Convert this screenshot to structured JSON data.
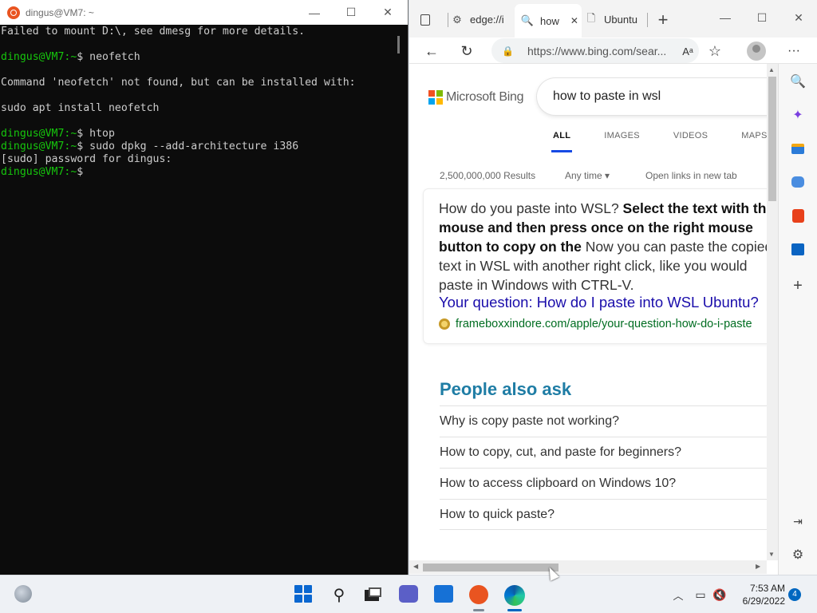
{
  "terminal": {
    "title": "dingus@VM7: ~",
    "lines": [
      {
        "type": "out",
        "text": "Failed to mount D:\\, see dmesg for more details."
      },
      {
        "type": "blank",
        "text": ""
      },
      {
        "type": "cmd",
        "prompt": "dingus@VM7:~",
        "text": "$ neofetch"
      },
      {
        "type": "blank",
        "text": ""
      },
      {
        "type": "out",
        "text": "Command 'neofetch' not found, but can be installed with:"
      },
      {
        "type": "blank",
        "text": ""
      },
      {
        "type": "out",
        "text": "sudo apt install neofetch"
      },
      {
        "type": "blank",
        "text": ""
      },
      {
        "type": "cmd",
        "prompt": "dingus@VM7:~",
        "text": "$ htop"
      },
      {
        "type": "cmd",
        "prompt": "dingus@VM7:~",
        "text": "$ sudo dpkg --add-architecture i386"
      },
      {
        "type": "out",
        "text": "[sudo] password for dingus:"
      },
      {
        "type": "cmd",
        "prompt": "dingus@VM7:~",
        "text": "$"
      }
    ],
    "buttons": {
      "minimize": "—",
      "maximize": "☐",
      "close": "✕"
    }
  },
  "edge": {
    "tabs": [
      {
        "label": "edge://i",
        "icon": "edge-settings-icon"
      },
      {
        "label": "how",
        "icon": "search-icon",
        "active": true
      },
      {
        "label": "Ubuntu",
        "icon": "page-icon"
      }
    ],
    "tab_close": "✕",
    "new_tab": "+",
    "window_buttons": {
      "minimize": "—",
      "maximize": "☐",
      "close": "✕"
    },
    "url": "https://www.bing.com/sear...",
    "read_aloud": "Aᵃ",
    "menu": "···"
  },
  "bing": {
    "brand": "Microsoft Bing",
    "query": "how to paste in wsl",
    "scopes": [
      "ALL",
      "IMAGES",
      "VIDEOS",
      "MAPS"
    ],
    "results_count": "2,500,000,000 Results",
    "any_time": "Any time",
    "open_links": "Open links in new tab",
    "answer": {
      "question": "How do you paste into WSL? ",
      "bold": "Select the text with the mouse and then press once on the right mouse button to copy on the",
      "rest": " Now you can paste the copied text in WSL with another right click, like you would paste in Windows with CTRL-V.",
      "link": "Your question: How do I paste into WSL Ubuntu?",
      "source": "frameboxxindore.com/apple/your-question-how-do-i-paste"
    },
    "people_also_ask": {
      "title": "People also ask",
      "items": [
        "Why is copy paste not working?",
        "How to copy, cut, and paste for beginners?",
        "How to access clipboard on Windows 10?",
        "How to quick paste?"
      ]
    }
  },
  "taskbar": {
    "time": "7:53 AM",
    "date": "6/29/2022",
    "notifications": "4"
  },
  "colors": {
    "prompt_green": "#16c60c",
    "bing_blue_link": "#1a0dab",
    "paa_title": "#1f7da5",
    "scope_underline": "#174ae4"
  }
}
